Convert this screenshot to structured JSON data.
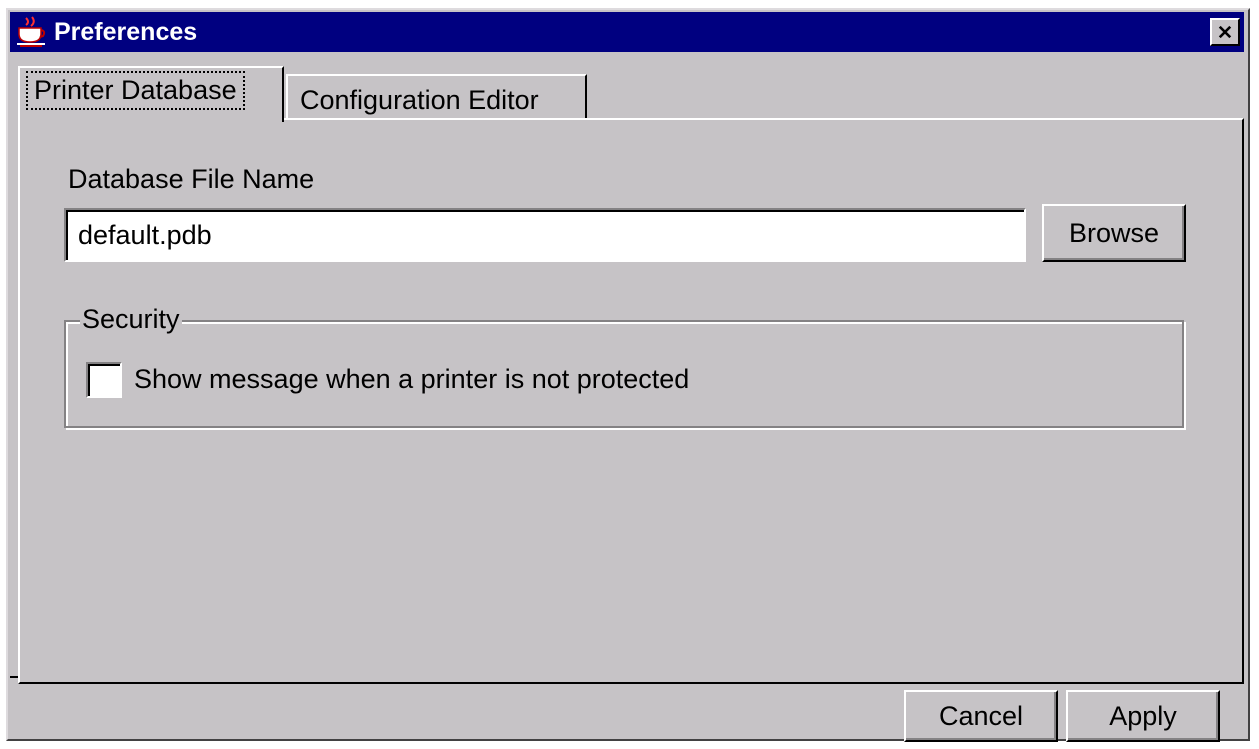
{
  "window": {
    "title": "Preferences",
    "icons": {
      "app": "java-cup-icon",
      "close": "close-icon"
    }
  },
  "tabs": [
    {
      "label": "Printer Database",
      "active": true
    },
    {
      "label": "Configuration Editor",
      "active": false
    }
  ],
  "database": {
    "label": "Database File Name",
    "value": "default.pdb",
    "browse_label": "Browse"
  },
  "security": {
    "legend": "Security",
    "checkbox_label": "Show message when a printer is not protected",
    "checked": false
  },
  "footer": {
    "cancel_label": "Cancel",
    "apply_label": "Apply"
  },
  "colors": {
    "title_bar": "#000080",
    "face": "#c6c3c6",
    "shadow": "#848284",
    "highlight": "#ffffff"
  }
}
